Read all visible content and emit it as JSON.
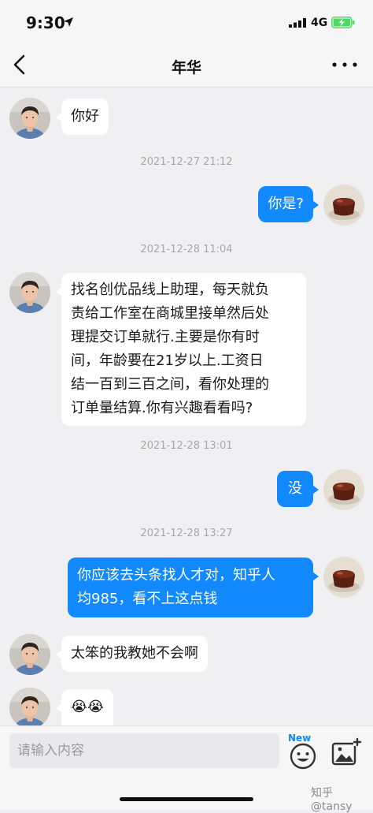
{
  "status_bar": {
    "time": "9:30",
    "network": "4G"
  },
  "nav": {
    "title": "年华"
  },
  "timestamps": [
    "2021-12-27 21:12",
    "2021-12-28 11:04",
    "2021-12-28 13:01",
    "2021-12-28 13:27"
  ],
  "messages": [
    {
      "side": "left",
      "text": "你好"
    },
    {
      "side": "right",
      "text": "你是?"
    },
    {
      "side": "left",
      "lines": [
        "找名创优品线上助理，每天就负",
        "责给工作室在商城里接单然后处",
        "理提交订单就行.主要是你有时",
        "间，年龄要在21岁以上.工资日",
        "结一百到三百之间，看你处理的",
        "订单量结算.你有兴趣看看吗?"
      ]
    },
    {
      "side": "right",
      "text": "没"
    },
    {
      "side": "right",
      "lines": [
        "你应该去头条找人才对，知乎人",
        "均985，看不上这点钱"
      ]
    },
    {
      "side": "left",
      "text": "太笨的我教她不会啊"
    },
    {
      "side": "left",
      "text": "😭😭"
    }
  ],
  "input": {
    "placeholder": "请输入内容",
    "emoji_badge": "New"
  },
  "watermark": "知乎 @tansy",
  "colors": {
    "bubble_right": "#1389ff",
    "bubble_left": "#ffffff",
    "background": "#f0f0f2"
  }
}
